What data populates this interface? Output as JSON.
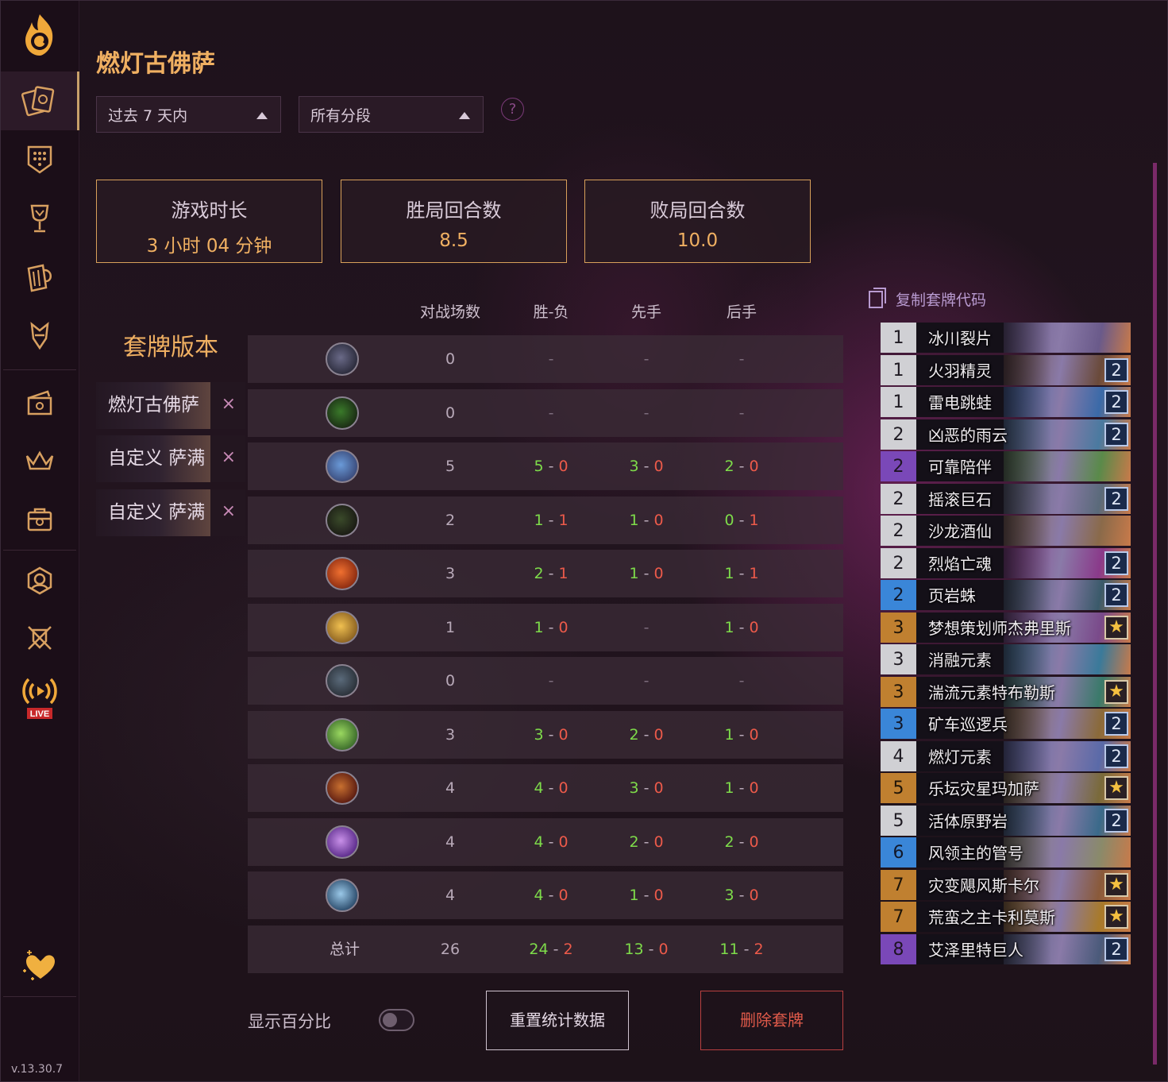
{
  "app": {
    "version": "v.13.30.7"
  },
  "header": {
    "title": "燃灯古佛萨",
    "time_filter": "过去 7 天内",
    "rank_filter": "所有分段",
    "help": "?"
  },
  "stats": [
    {
      "label": "游戏时长",
      "value": "3 小时 04 分钟"
    },
    {
      "label": "胜局回合数",
      "value": "8.5"
    },
    {
      "label": "败局回合数",
      "value": "10.0"
    }
  ],
  "versions": {
    "title": "套牌版本",
    "items": [
      {
        "name": "燃灯古佛萨"
      },
      {
        "name": "自定义 萨满"
      },
      {
        "name": "自定义 萨满"
      }
    ],
    "remove_glyph": "×"
  },
  "table": {
    "headers": {
      "games": "对战场数",
      "wl": "胜-负",
      "first": "先手",
      "second": "后手"
    },
    "rows": [
      {
        "cls": "rogue",
        "games": "0",
        "wl": [
          "-",
          ""
        ],
        "first": [
          "-",
          ""
        ],
        "second": [
          "-",
          ""
        ]
      },
      {
        "cls": "druid",
        "games": "0",
        "wl": [
          "-",
          ""
        ],
        "first": [
          "-",
          ""
        ],
        "second": [
          "-",
          ""
        ]
      },
      {
        "cls": "shaman",
        "games": "5",
        "wl": [
          "5",
          "0"
        ],
        "first": [
          "3",
          "0"
        ],
        "second": [
          "2",
          "0"
        ]
      },
      {
        "cls": "hunter",
        "games": "2",
        "wl": [
          "1",
          "1"
        ],
        "first": [
          "1",
          "0"
        ],
        "second": [
          "0",
          "1"
        ]
      },
      {
        "cls": "mage",
        "games": "3",
        "wl": [
          "2",
          "1"
        ],
        "first": [
          "1",
          "0"
        ],
        "second": [
          "1",
          "1"
        ]
      },
      {
        "cls": "paladin",
        "games": "1",
        "wl": [
          "1",
          "0"
        ],
        "first": [
          "-",
          ""
        ],
        "second": [
          "1",
          "0"
        ]
      },
      {
        "cls": "warrior",
        "games": "0",
        "wl": [
          "-",
          ""
        ],
        "first": [
          "-",
          ""
        ],
        "second": [
          "-",
          ""
        ]
      },
      {
        "cls": "priest",
        "games": "3",
        "wl": [
          "3",
          "0"
        ],
        "first": [
          "2",
          "0"
        ],
        "second": [
          "1",
          "0"
        ]
      },
      {
        "cls": "warlock",
        "games": "4",
        "wl": [
          "4",
          "0"
        ],
        "first": [
          "3",
          "0"
        ],
        "second": [
          "1",
          "0"
        ]
      },
      {
        "cls": "demon-hunter",
        "games": "4",
        "wl": [
          "4",
          "0"
        ],
        "first": [
          "2",
          "0"
        ],
        "second": [
          "2",
          "0"
        ]
      },
      {
        "cls": "death-knight",
        "games": "4",
        "wl": [
          "4",
          "0"
        ],
        "first": [
          "1",
          "0"
        ],
        "second": [
          "3",
          "0"
        ]
      }
    ],
    "total": {
      "label": "总计",
      "games": "26",
      "wl": [
        "24",
        "2"
      ],
      "first": [
        "13",
        "0"
      ],
      "second": [
        "11",
        "2"
      ]
    }
  },
  "controls": {
    "show_percent": "显示百分比",
    "reset": "重置统计数据",
    "delete": "删除套牌"
  },
  "deck": {
    "copy_code": "复制套牌代码",
    "cards": [
      {
        "cost": "1",
        "name": "冰川裂片",
        "count": "",
        "rarity": "common",
        "color": "#6a5a8a"
      },
      {
        "cost": "1",
        "name": "火羽精灵",
        "count": "2",
        "rarity": "common",
        "color": "#6a4a3a"
      },
      {
        "cost": "1",
        "name": "雷电跳蛙",
        "count": "2",
        "rarity": "common",
        "color": "#3a6aa8"
      },
      {
        "cost": "2",
        "name": "凶恶的雨云",
        "count": "2",
        "rarity": "common",
        "color": "#4a7aa0"
      },
      {
        "cost": "2",
        "name": "可靠陪伴",
        "count": "",
        "rarity": "epic",
        "color": "#5a8a4a"
      },
      {
        "cost": "2",
        "name": "摇滚巨石",
        "count": "2",
        "rarity": "common",
        "color": "#5a6a7a"
      },
      {
        "cost": "2",
        "name": "沙龙酒仙",
        "count": "",
        "rarity": "common",
        "color": "#8a6a4a"
      },
      {
        "cost": "2",
        "name": "烈焰亡魂",
        "count": "2",
        "rarity": "common",
        "color": "#8a3a8a"
      },
      {
        "cost": "2",
        "name": "页岩蛛",
        "count": "2",
        "rarity": "rare",
        "color": "#3a5a6a"
      },
      {
        "cost": "3",
        "name": "梦想策划师杰弗里斯",
        "count": "★",
        "rarity": "legendary",
        "color": "#7a4a8a"
      },
      {
        "cost": "3",
        "name": "消融元素",
        "count": "",
        "rarity": "common",
        "color": "#3a7a9a"
      },
      {
        "cost": "3",
        "name": "湍流元素特布勒斯",
        "count": "★",
        "rarity": "legendary",
        "color": "#3a7a6a"
      },
      {
        "cost": "3",
        "name": "矿车巡逻兵",
        "count": "2",
        "rarity": "rare",
        "color": "#8a6a3a"
      },
      {
        "cost": "4",
        "name": "燃灯元素",
        "count": "2",
        "rarity": "common",
        "color": "#5a6aa8"
      },
      {
        "cost": "5",
        "name": "乐坛灾星玛加萨",
        "count": "★",
        "rarity": "legendary",
        "color": "#7a6a3a"
      },
      {
        "cost": "5",
        "name": "活体原野岩",
        "count": "2",
        "rarity": "common",
        "color": "#3a6a8a"
      },
      {
        "cost": "6",
        "name": "风领主的管号",
        "count": "",
        "rarity": "rare",
        "color": "#8a8a6a"
      },
      {
        "cost": "7",
        "name": "灾变飓风斯卡尔",
        "count": "★",
        "rarity": "legendary",
        "color": "#8a5a3a"
      },
      {
        "cost": "7",
        "name": "荒蛮之主卡利莫斯",
        "count": "★",
        "rarity": "legendary",
        "color": "#a87a2a"
      },
      {
        "cost": "8",
        "name": "艾泽里特巨人",
        "count": "2",
        "rarity": "epic",
        "color": "#4a5a7a"
      }
    ]
  }
}
